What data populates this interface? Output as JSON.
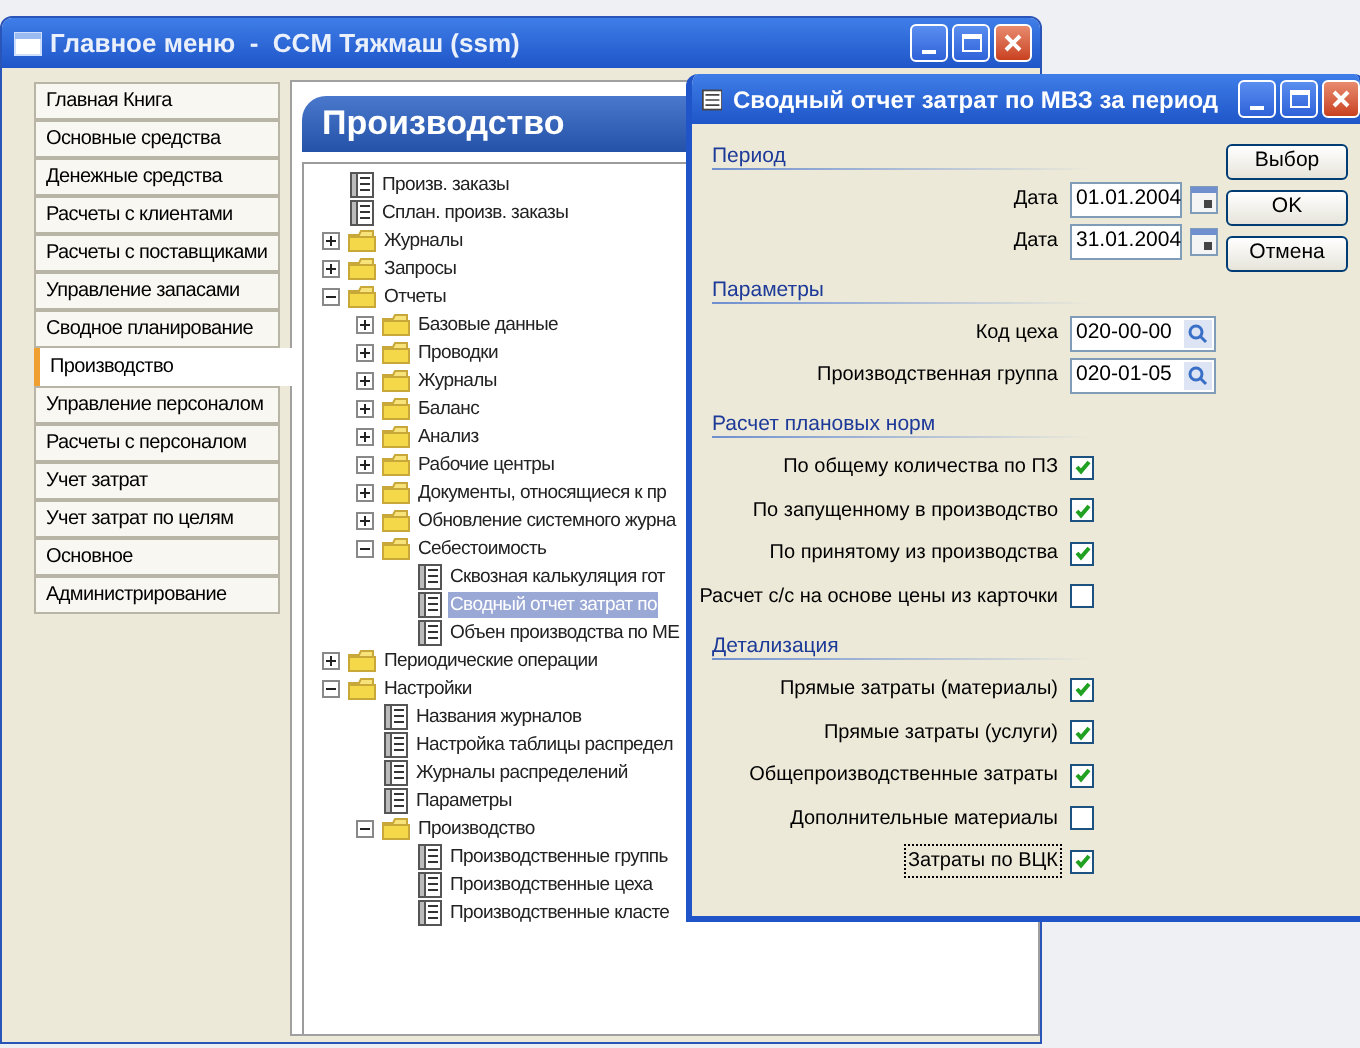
{
  "main_window": {
    "title": "Главное меню  -  CCM Тяжмаш (ssm)"
  },
  "menu": [
    {
      "label": "Главная Книга",
      "selected": false
    },
    {
      "label": "Основные средства",
      "selected": false
    },
    {
      "label": "Денежные средства",
      "selected": false
    },
    {
      "label": "Расчеты с клиентами",
      "selected": false
    },
    {
      "label": "Расчеты с поставщиками",
      "selected": false
    },
    {
      "label": "Управление запасами",
      "selected": false
    },
    {
      "label": "Сводное планирование",
      "selected": false
    },
    {
      "label": "Производство",
      "selected": true
    },
    {
      "label": "Управление персоналом",
      "selected": false
    },
    {
      "label": "Расчеты с персоналом",
      "selected": false
    },
    {
      "label": "Учет затрат",
      "selected": false
    },
    {
      "label": "Учет затрат по целям",
      "selected": false
    },
    {
      "label": "Основное",
      "selected": false
    },
    {
      "label": "Администрирование",
      "selected": false
    }
  ],
  "panel": {
    "title": "Производство"
  },
  "tree": [
    {
      "kind": "doc",
      "label": "Произв. заказы",
      "selected": false
    },
    {
      "kind": "doc",
      "label": "Сплан. произв. заказы",
      "selected": false
    },
    {
      "kind": "folder",
      "label": "Журналы",
      "expanded": false,
      "selected": false
    },
    {
      "kind": "folder",
      "label": "Запросы",
      "expanded": false,
      "selected": false
    },
    {
      "kind": "folder",
      "label": "Отчеты",
      "expanded": true,
      "selected": false,
      "children": [
        {
          "kind": "folder",
          "label": "Базовые данные",
          "expanded": false,
          "selected": false
        },
        {
          "kind": "folder",
          "label": "Проводки",
          "expanded": false,
          "selected": false
        },
        {
          "kind": "folder",
          "label": "Журналы",
          "expanded": false,
          "selected": false
        },
        {
          "kind": "folder",
          "label": "Баланс",
          "expanded": false,
          "selected": false
        },
        {
          "kind": "folder",
          "label": "Анализ",
          "expanded": false,
          "selected": false
        },
        {
          "kind": "folder",
          "label": "Рабочие центры",
          "expanded": false,
          "selected": false
        },
        {
          "kind": "folder",
          "label": "Документы, относящиеся к пр",
          "expanded": false,
          "selected": false
        },
        {
          "kind": "folder",
          "label": "Обновление системного журна",
          "expanded": false,
          "selected": false
        },
        {
          "kind": "folder",
          "label": "Себестоимость",
          "expanded": true,
          "selected": false,
          "children": [
            {
              "kind": "doc",
              "label": "Сквозная калькуляция гот",
              "selected": false
            },
            {
              "kind": "doc",
              "label": "Сводный отчет затрат по",
              "selected": true
            },
            {
              "kind": "doc",
              "label": "Объен производства по МЕ",
              "selected": false
            }
          ]
        }
      ]
    },
    {
      "kind": "folder",
      "label": "Периодические операции",
      "expanded": false,
      "selected": false
    },
    {
      "kind": "folder",
      "label": "Настройки",
      "expanded": true,
      "selected": false,
      "children": [
        {
          "kind": "doc",
          "label": "Названия журналов",
          "selected": false
        },
        {
          "kind": "doc",
          "label": "Настройка таблицы распредел",
          "selected": false
        },
        {
          "kind": "doc",
          "label": "Журналы распределений",
          "selected": false
        },
        {
          "kind": "doc",
          "label": "Параметры",
          "selected": false
        },
        {
          "kind": "folder",
          "label": "Производство",
          "expanded": true,
          "selected": false,
          "children": [
            {
              "kind": "doc",
              "label": "Производственные группь",
              "selected": false
            },
            {
              "kind": "doc",
              "label": "Производственные цеха",
              "selected": false
            },
            {
              "kind": "doc",
              "label": "Производственные класте",
              "selected": false
            }
          ]
        }
      ]
    }
  ],
  "dialog": {
    "title": "Сводный отчет затрат по МВЗ за период",
    "sections": [
      {
        "heading": "Период",
        "fields": [
          {
            "kind": "date",
            "label": "Дата",
            "value": "01.01.2004"
          },
          {
            "kind": "date",
            "label": "Дата",
            "value": "31.01.2004"
          }
        ]
      },
      {
        "heading": "Параметры",
        "fields": [
          {
            "kind": "lookup",
            "label": "Код цеха",
            "value": "020-00-00"
          },
          {
            "kind": "lookup",
            "label": "Производственная группа",
            "value": "020-01-05"
          }
        ]
      },
      {
        "heading": "Расчет плановых норм",
        "fields": [
          {
            "kind": "checkbox",
            "label": "По общему количества по ПЗ",
            "checked": true,
            "focused": false
          },
          {
            "kind": "checkbox",
            "label": "По запущенному в производство",
            "checked": true,
            "focused": false
          },
          {
            "kind": "checkbox",
            "label": "По принятому из производства",
            "checked": true,
            "focused": false
          },
          {
            "kind": "checkbox",
            "label": "Расчет с/с на основе цены из карточки",
            "checked": false,
            "focused": false
          }
        ]
      },
      {
        "heading": "Детализация",
        "fields": [
          {
            "kind": "checkbox",
            "label": "Прямые затраты (материалы)",
            "checked": true,
            "focused": false
          },
          {
            "kind": "checkbox",
            "label": "Прямые затраты (услуги)",
            "checked": true,
            "focused": false
          },
          {
            "kind": "checkbox",
            "label": "Общепроизводственные затраты",
            "checked": true,
            "focused": false
          },
          {
            "kind": "checkbox",
            "label": "Дополнительные материалы",
            "checked": false,
            "focused": false
          },
          {
            "kind": "checkbox",
            "label": "Затраты по ВЦК",
            "checked": true,
            "focused": true
          }
        ]
      }
    ],
    "buttons": [
      "Выбор",
      "OK",
      "Отмена"
    ]
  }
}
